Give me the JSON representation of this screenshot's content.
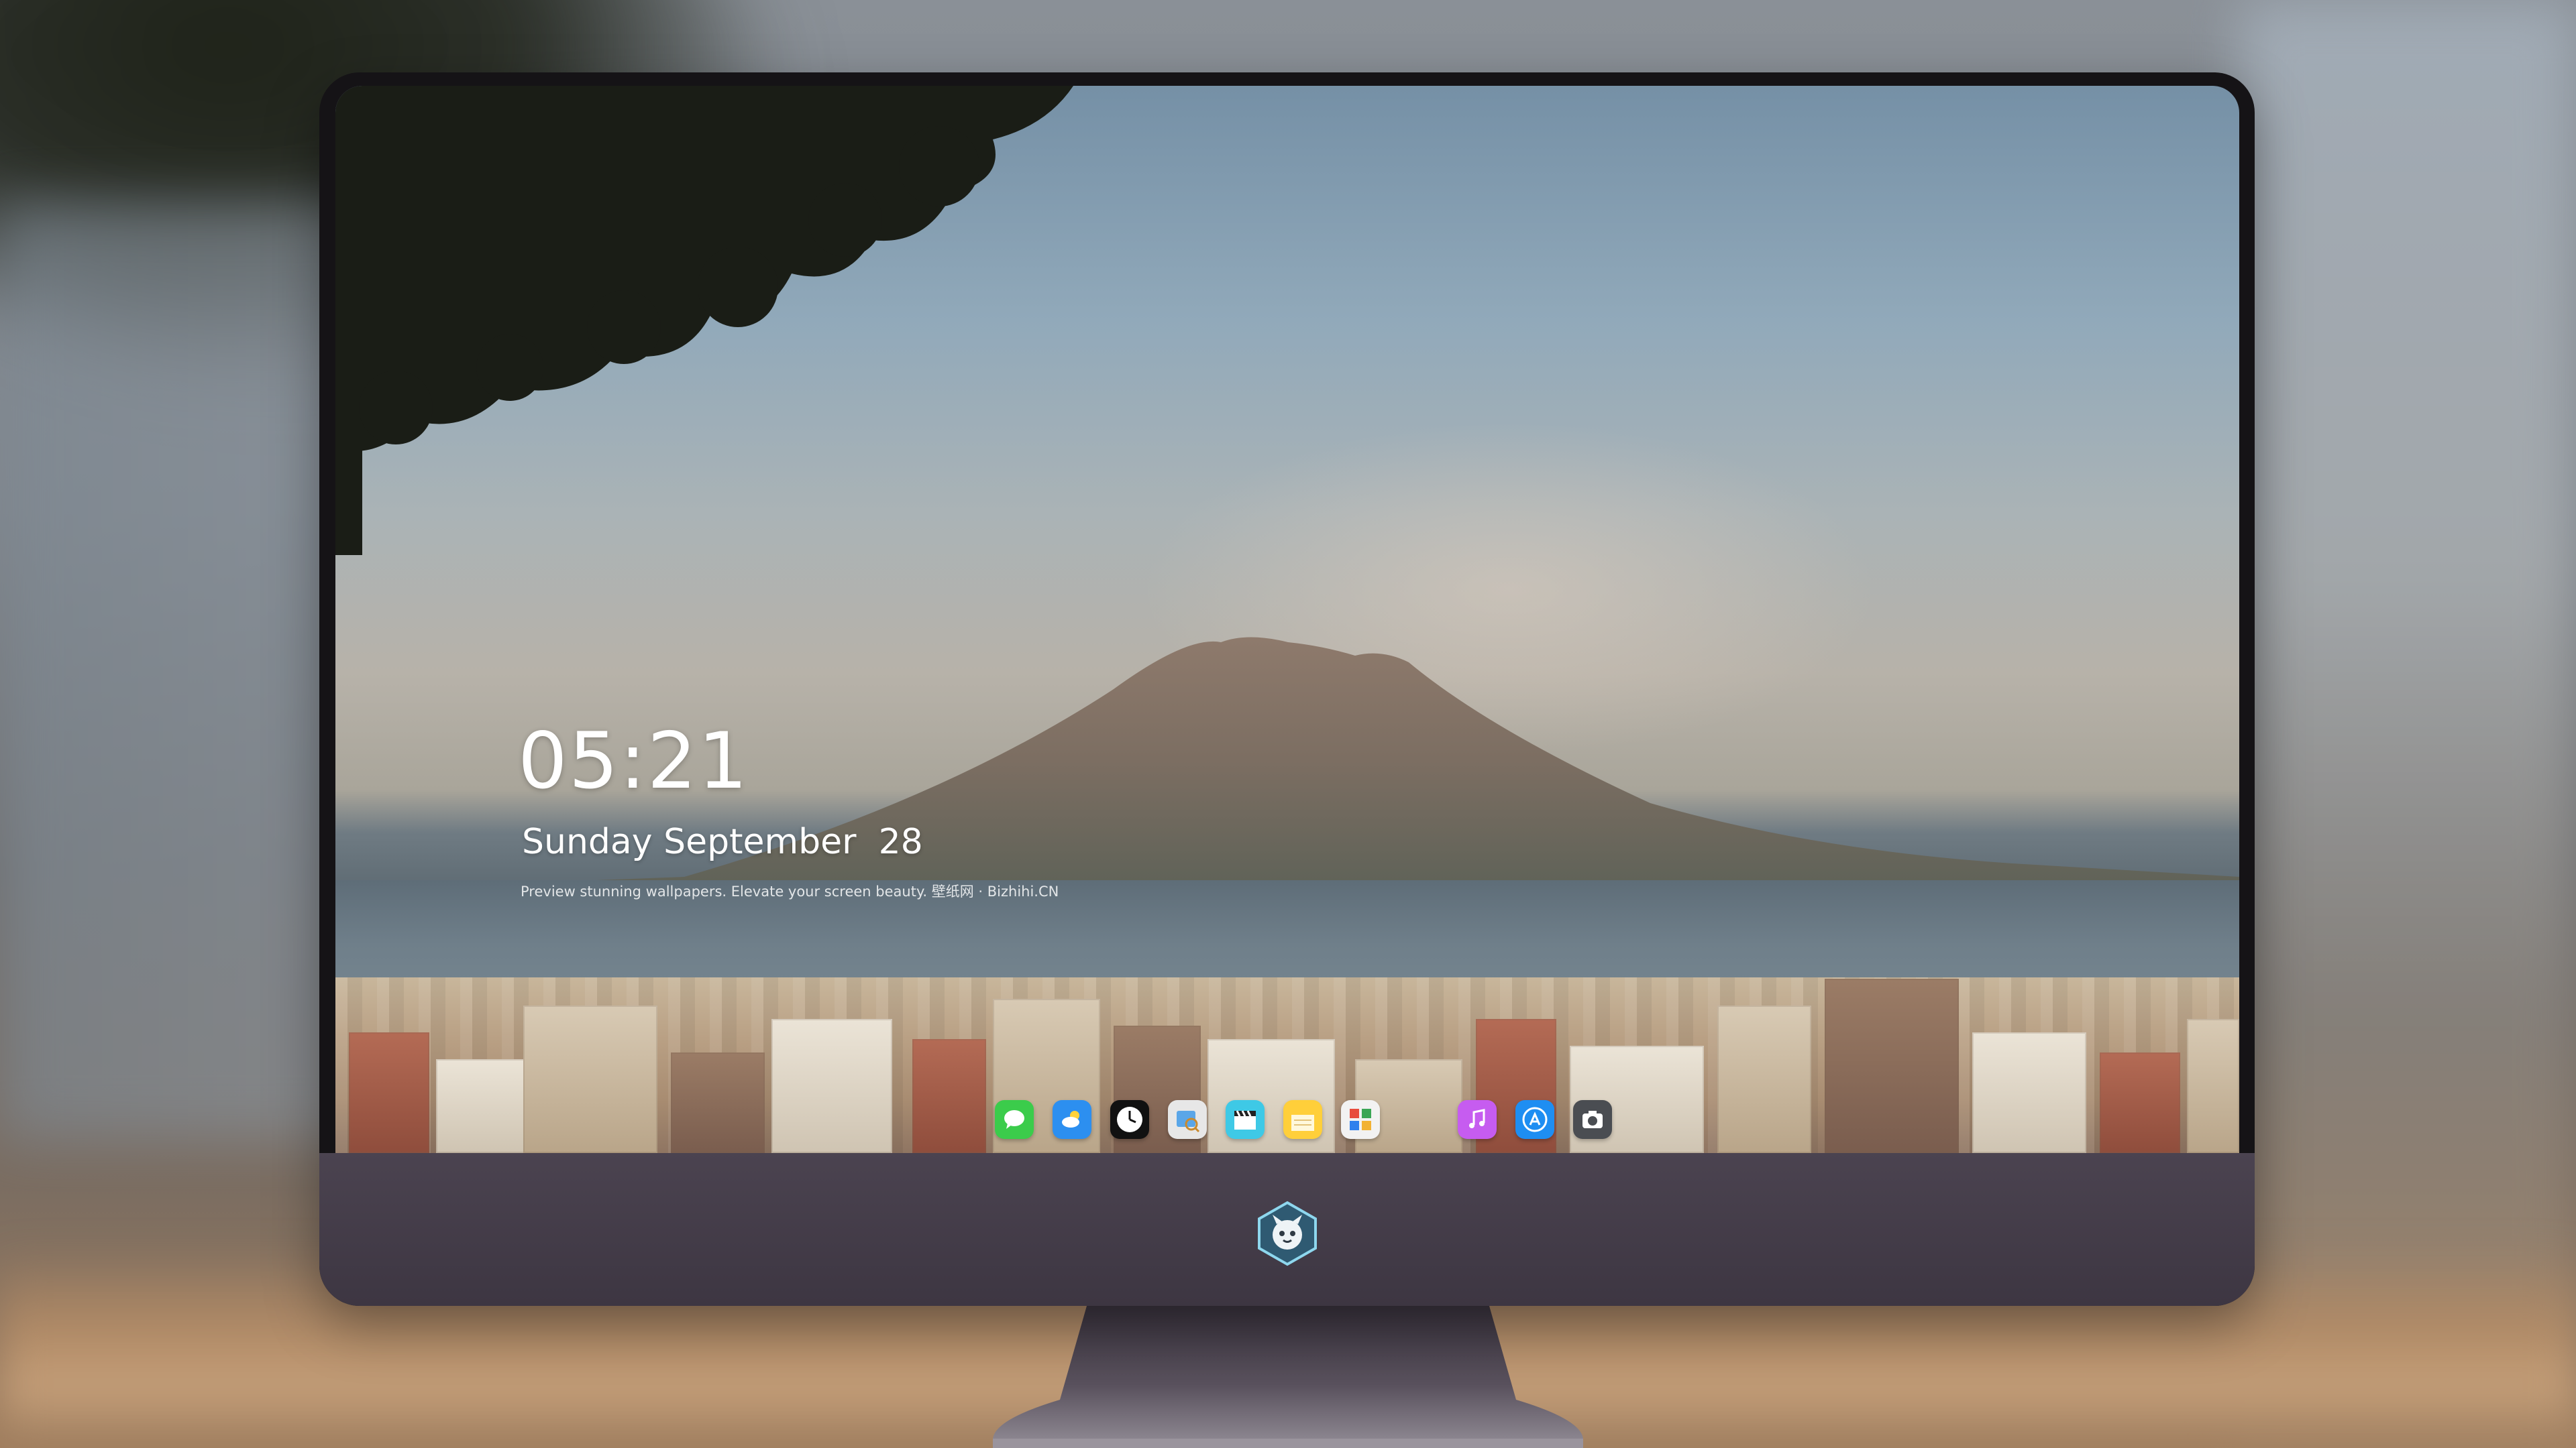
{
  "lockscreen": {
    "time": "05:21",
    "date": "Sunday September  28",
    "tagline": "Preview stunning wallpapers. Elevate your screen beauty. 壁纸网 · Bizhihi.CN"
  },
  "dock": {
    "apps": [
      {
        "name": "Messages",
        "icon": "message-bubble-icon",
        "color": "#3bcc4b"
      },
      {
        "name": "Weather",
        "icon": "cloud-sun-icon",
        "color": "#2c8ff0"
      },
      {
        "name": "Clock",
        "icon": "clock-icon",
        "color": "#111111"
      },
      {
        "name": "Preview",
        "icon": "preview-icon",
        "color": "#e7e7e7"
      },
      {
        "name": "Videos",
        "icon": "clapperboard-icon",
        "color": "#3ec9e6"
      },
      {
        "name": "Notes",
        "icon": "notes-icon",
        "color": "#ffcf3a"
      },
      {
        "name": "Photo Booth",
        "icon": "grid-app-icon",
        "color": "#f2f2f2"
      },
      {
        "name": "Music",
        "icon": "music-note-icon",
        "color": "#c65cf0"
      },
      {
        "name": "App Store",
        "icon": "app-store-icon",
        "color": "#1e8ef2"
      },
      {
        "name": "Camera",
        "icon": "camera-icon",
        "color": "#4a4d52"
      }
    ]
  },
  "monitor": {
    "logo": "mascot-logo-icon"
  }
}
